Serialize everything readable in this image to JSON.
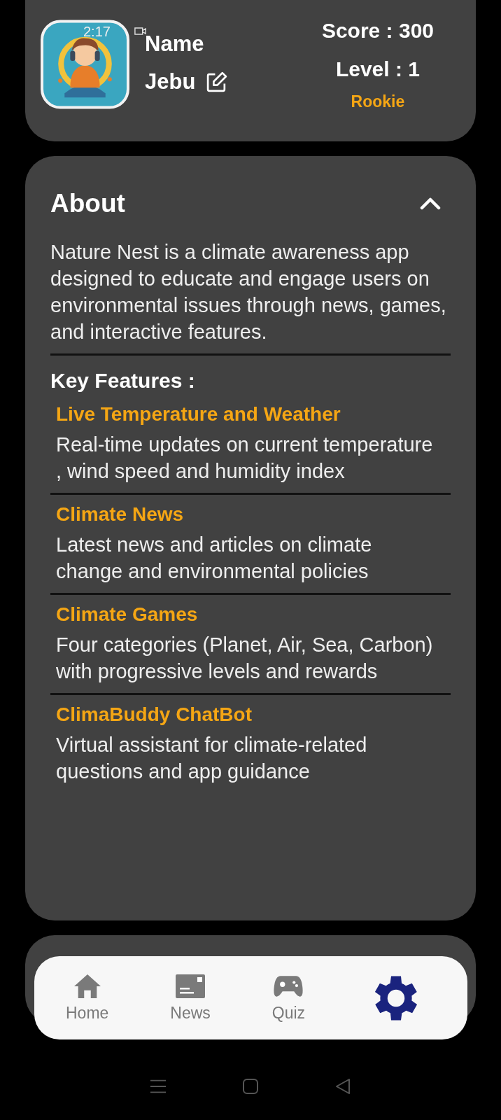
{
  "status_bar": {
    "time": "2:17"
  },
  "profile": {
    "name_label": "Name",
    "name": "Jebu",
    "score": "Score : 300",
    "level": "Level  : 1",
    "rank": "Rookie"
  },
  "about": {
    "title": "About",
    "expanded": true,
    "description": "Nature Nest is a climate awareness app designed to educate and engage users on environmental issues through news, games, and interactive features.",
    "features_heading": "Key Features :",
    "features": [
      {
        "title": "Live Temperature and Weather",
        "text": "Real-time updates on current temperature , wind speed and humidity index"
      },
      {
        "title": "Climate News",
        "text": "Latest news and articles on climate change and environmental policies"
      },
      {
        "title": "Climate Games",
        "text": "Four categories (Planet, Air, Sea, Carbon) with progressive levels and rewards"
      },
      {
        "title": "ClimaBuddy ChatBot",
        "text": "Virtual assistant for climate-related questions and app guidance"
      }
    ]
  },
  "nav": [
    {
      "kind": "home",
      "label": "Home",
      "selected": false
    },
    {
      "kind": "news",
      "label": "News",
      "selected": false
    },
    {
      "kind": "quiz",
      "label": "Quiz",
      "selected": false
    },
    {
      "kind": "settings",
      "selected": true
    }
  ]
}
